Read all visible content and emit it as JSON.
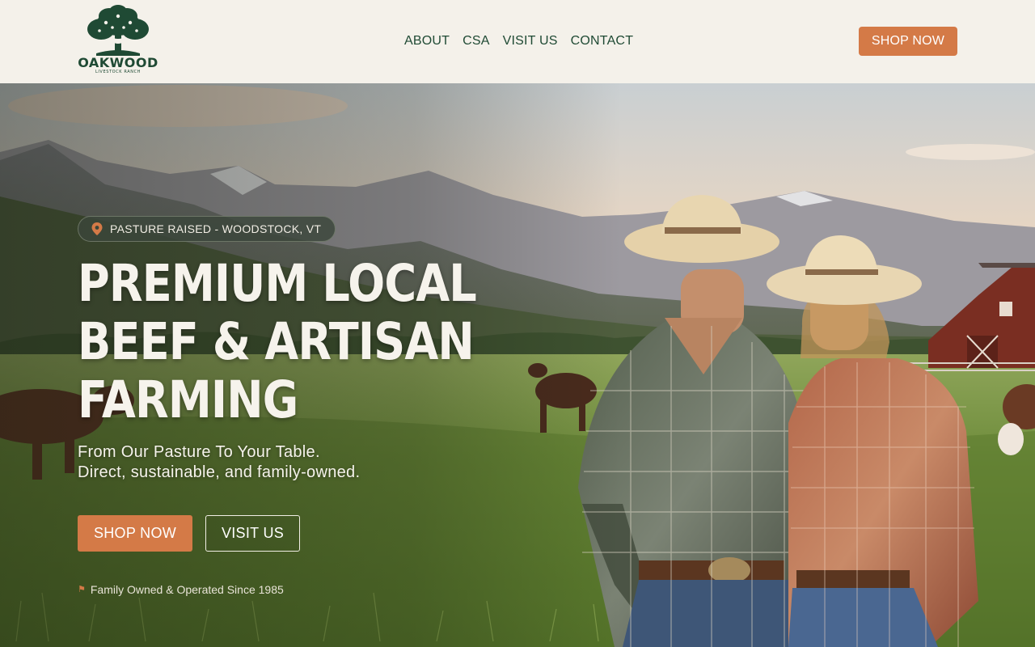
{
  "brand": {
    "name": "OAKWOOD",
    "tagline": "LIVESTOCK RANCH",
    "colors": {
      "forest": "#1f4a34",
      "accent": "#d47a47",
      "cream": "#f4f1ea"
    }
  },
  "nav": {
    "items": [
      {
        "label": "ABOUT"
      },
      {
        "label": "CSA"
      },
      {
        "label": "VISIT US"
      },
      {
        "label": "CONTACT"
      }
    ],
    "cta_label": "SHOP NOW"
  },
  "hero": {
    "location_icon": "map-pin-icon",
    "location": "PASTURE RAISED - WOODSTOCK, VT",
    "title_lines": [
      "PREMIUM LOCAL",
      "BEEF & ARTISAN",
      "FARMING"
    ],
    "subtitle_lines": [
      "From Our Pasture To Your Table.",
      "Direct, sustainable, and family-owned."
    ],
    "primary_cta": "SHOP NOW",
    "secondary_cta": "VISIT US",
    "since_icon": "flag-icon",
    "since": "Family Owned & Operated Since 1985"
  }
}
